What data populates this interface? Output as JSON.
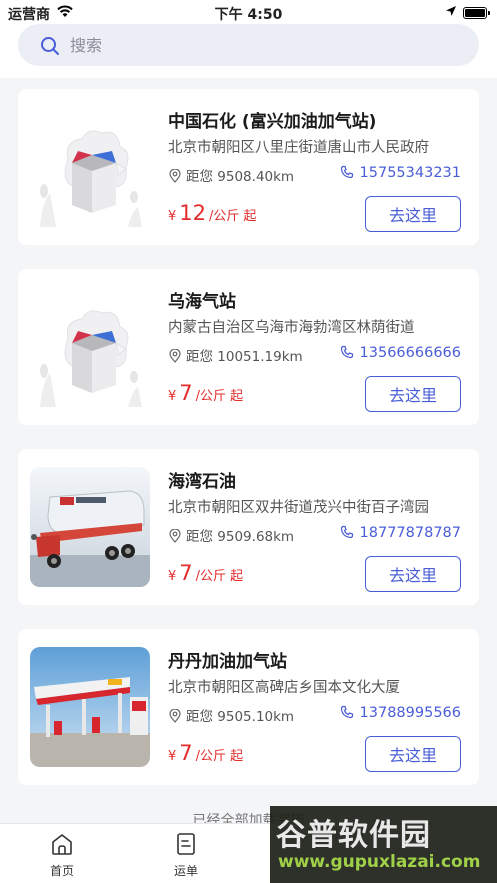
{
  "status_bar": {
    "carrier": "运营商",
    "time": "下午 4:50"
  },
  "search": {
    "placeholder": "搜索"
  },
  "stations": [
    {
      "name": "中国石化 (富兴加油加气站)",
      "address": "北京市朝阳区八里庄街道唐山市人民政府",
      "distance": "距您 9508.40km",
      "phone": "15755343231",
      "currency": "¥",
      "price": "12",
      "unit": "/公斤 起",
      "button": "去这里",
      "image": "placeholder-box"
    },
    {
      "name": "乌海气站",
      "address": "内蒙古自治区乌海市海勃湾区林荫街道",
      "distance": "距您 10051.19km",
      "phone": "13566666666",
      "currency": "¥",
      "price": "7",
      "unit": "/公斤 起",
      "button": "去这里",
      "image": "placeholder-box"
    },
    {
      "name": "海湾石油",
      "address": "北京市朝阳区双井街道茂兴中街百子湾园",
      "distance": "距您 9509.68km",
      "phone": "18777878787",
      "currency": "¥",
      "price": "7",
      "unit": "/公斤 起",
      "button": "去这里",
      "image": "tanker-truck"
    },
    {
      "name": "丹丹加油加气站",
      "address": "北京市朝阳区高碑店乡国本文化大厦",
      "distance": "距您 9505.10km",
      "phone": "13788995566",
      "currency": "¥",
      "price": "7",
      "unit": "/公斤 起",
      "button": "去这里",
      "image": "gas-station"
    }
  ],
  "end_text": "已经全部加载完毕",
  "tabs": [
    {
      "label": "首页",
      "icon": "home-icon"
    },
    {
      "label": "运单",
      "icon": "waybill-icon"
    }
  ],
  "watermark": {
    "text": "谷普软件园",
    "url": "www.gupuxlazai.com"
  },
  "colors": {
    "accent": "#4a5dd8",
    "price": "#e32d2d",
    "background": "#f4f5f7"
  }
}
